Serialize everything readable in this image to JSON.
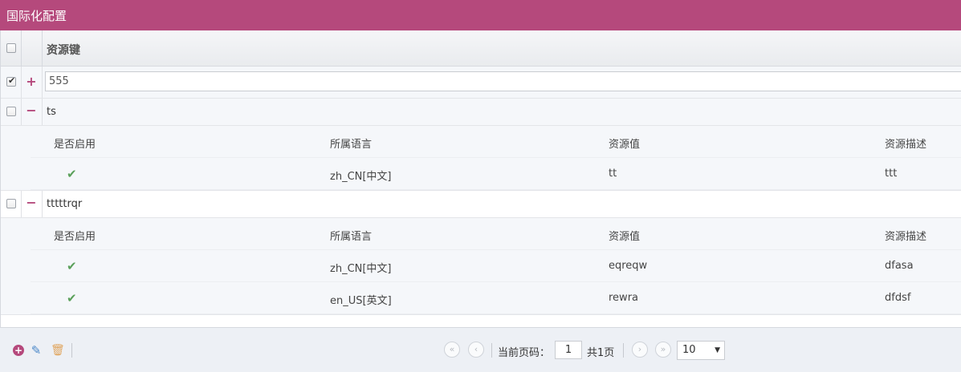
{
  "window": {
    "title": "国际化配置"
  },
  "grid": {
    "header": {
      "column_label": "资源键"
    },
    "rows": [
      {
        "key": "555",
        "checked": true,
        "expanded": false,
        "toggle": "+"
      },
      {
        "key": "ts",
        "checked": false,
        "expanded": true,
        "toggle": "−"
      },
      {
        "key": "tttttrqr",
        "checked": false,
        "expanded": true,
        "toggle": "−"
      }
    ],
    "sub_headers": [
      "是否启用",
      "所属语言",
      "资源值",
      "资源描述"
    ],
    "sub_tables": [
      {
        "rows": [
          {
            "enabled": true,
            "language": "zh_CN[中文]",
            "value": "tt",
            "description": "ttt"
          }
        ]
      },
      {
        "rows": [
          {
            "enabled": true,
            "language": "zh_CN[中文]",
            "value": "eqreqw",
            "description": "dfasa"
          },
          {
            "enabled": true,
            "language": "en_US[英文]",
            "value": "rewra",
            "description": "dfdsf"
          }
        ]
      }
    ]
  },
  "pager": {
    "current_page_label": "当前页码：",
    "current_page": "1",
    "total_pages_label": "共1页",
    "page_size": "10"
  },
  "icons": {
    "check": "✔",
    "add": "+",
    "edit": "✎",
    "delete": "🗑",
    "first": "«",
    "prev": "‹",
    "next": "›",
    "last": "»",
    "caret": "▼"
  },
  "colors": {
    "accent": "#b5497c",
    "check": "#5aa05a",
    "edit": "#4a87c8",
    "delete": "#e0a45c"
  }
}
